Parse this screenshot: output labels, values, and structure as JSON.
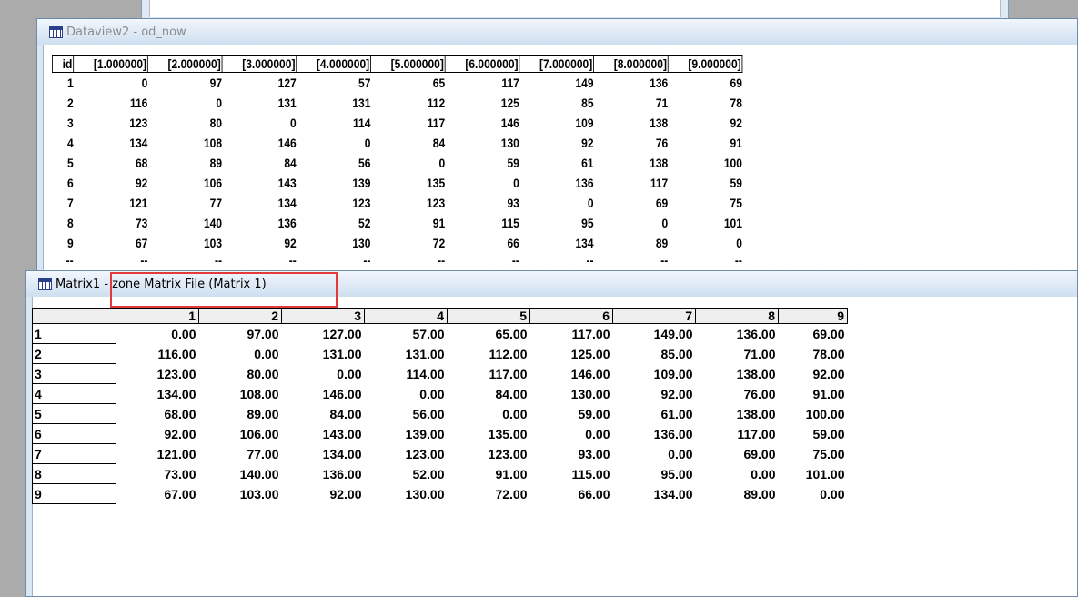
{
  "dataview": {
    "title": "Dataview2 - od_now",
    "headers": [
      "id",
      "[1.000000]",
      "[2.000000]",
      "[3.000000]",
      "[4.000000]",
      "[5.000000]",
      "[6.000000]",
      "[7.000000]",
      "[8.000000]",
      "[9.000000]"
    ],
    "rows": [
      [
        "1",
        "0",
        "97",
        "127",
        "57",
        "65",
        "117",
        "149",
        "136",
        "69"
      ],
      [
        "2",
        "116",
        "0",
        "131",
        "131",
        "112",
        "125",
        "85",
        "71",
        "78"
      ],
      [
        "3",
        "123",
        "80",
        "0",
        "114",
        "117",
        "146",
        "109",
        "138",
        "92"
      ],
      [
        "4",
        "134",
        "108",
        "146",
        "0",
        "84",
        "130",
        "92",
        "76",
        "91"
      ],
      [
        "5",
        "68",
        "89",
        "84",
        "56",
        "0",
        "59",
        "61",
        "138",
        "100"
      ],
      [
        "6",
        "92",
        "106",
        "143",
        "139",
        "135",
        "0",
        "136",
        "117",
        "59"
      ],
      [
        "7",
        "121",
        "77",
        "134",
        "123",
        "123",
        "93",
        "0",
        "69",
        "75"
      ],
      [
        "8",
        "73",
        "140",
        "136",
        "52",
        "91",
        "115",
        "95",
        "0",
        "101"
      ],
      [
        "9",
        "67",
        "103",
        "92",
        "130",
        "72",
        "66",
        "134",
        "89",
        "0"
      ],
      [
        "--",
        "--",
        "--",
        "--",
        "--",
        "--",
        "--",
        "--",
        "--",
        "--"
      ]
    ]
  },
  "matrix": {
    "title": "Matrix1 - zone Matrix File (Matrix 1)",
    "col_headers": [
      "1",
      "2",
      "3",
      "4",
      "5",
      "6",
      "7",
      "8",
      "9"
    ],
    "rows": [
      {
        "label": "1",
        "values": [
          "0.00",
          "97.00",
          "127.00",
          "57.00",
          "65.00",
          "117.00",
          "149.00",
          "136.00",
          "69.00"
        ]
      },
      {
        "label": "2",
        "values": [
          "116.00",
          "0.00",
          "131.00",
          "131.00",
          "112.00",
          "125.00",
          "85.00",
          "71.00",
          "78.00"
        ]
      },
      {
        "label": "3",
        "values": [
          "123.00",
          "80.00",
          "0.00",
          "114.00",
          "117.00",
          "146.00",
          "109.00",
          "138.00",
          "92.00"
        ]
      },
      {
        "label": "4",
        "values": [
          "134.00",
          "108.00",
          "146.00",
          "0.00",
          "84.00",
          "130.00",
          "92.00",
          "76.00",
          "91.00"
        ]
      },
      {
        "label": "5",
        "values": [
          "68.00",
          "89.00",
          "84.00",
          "56.00",
          "0.00",
          "59.00",
          "61.00",
          "138.00",
          "100.00"
        ]
      },
      {
        "label": "6",
        "values": [
          "92.00",
          "106.00",
          "143.00",
          "139.00",
          "135.00",
          "0.00",
          "136.00",
          "117.00",
          "59.00"
        ]
      },
      {
        "label": "7",
        "values": [
          "121.00",
          "77.00",
          "134.00",
          "123.00",
          "123.00",
          "93.00",
          "0.00",
          "69.00",
          "75.00"
        ]
      },
      {
        "label": "8",
        "values": [
          "73.00",
          "140.00",
          "136.00",
          "52.00",
          "91.00",
          "115.00",
          "95.00",
          "0.00",
          "101.00"
        ]
      },
      {
        "label": "9",
        "values": [
          "67.00",
          "103.00",
          "92.00",
          "130.00",
          "72.00",
          "66.00",
          "134.00",
          "89.00",
          "0.00"
        ]
      }
    ]
  },
  "colors": {
    "highlight": "#e23a3a",
    "title_bg": "#dbe6f3"
  }
}
